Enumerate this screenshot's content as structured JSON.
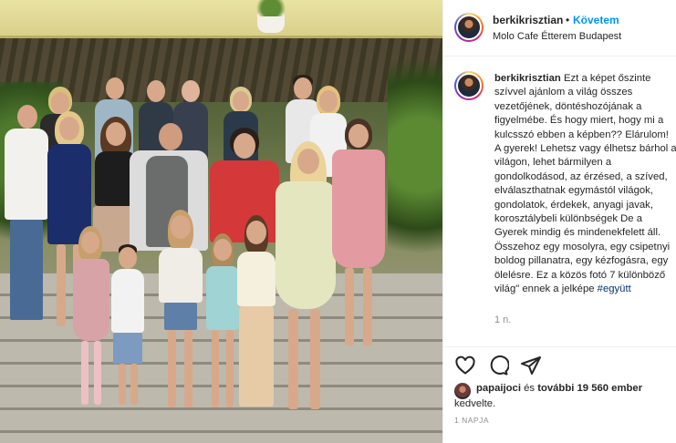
{
  "post": {
    "username": "berkikrisztian",
    "separator": "•",
    "follow_label": "Követem",
    "location": "Molo Cafe Étterem Budapest"
  },
  "caption": {
    "username": "berkikrisztian",
    "text": "Ezt a képet őszinte szívvel ajánlom a világ összes vezetőjének, döntéshozójának a figyelmébe. És hogy miert, hogy mi a kulcsszó ebben a képben?? Elárulom! A gyerek! Lehetsz vagy élhetsz bárhol a világon, lehet bármilyen a gondolkodásod, az érzésed, a szíved, elválaszthatnak egymástól világok, gondolatok, érdekek, anyagi javak, korosztálybeli különbségek De a Gyerek mindig és mindenekfelett áll. Összehoz egy mosolyra, egy csipetnyi boldog pillanatra, egy kézfogásra, egy ölelésre. Ez a közös fotó 7 különböző világ\" ennek a jelképe ",
    "hashtag": "#együtt",
    "time_ago": "1 n."
  },
  "actions": {
    "like_icon": "heart-icon",
    "comment_icon": "comment-icon",
    "share_icon": "share-icon"
  },
  "likes": {
    "liker": "papaijoci",
    "and_text": " és ",
    "others": "további 19 560 ember",
    "line2": "kedvelte."
  },
  "date": "1 NAPJA",
  "colors": {
    "accent": "#0095f6",
    "text": "#262626",
    "muted": "#8e8e8e",
    "border": "#efefef"
  }
}
